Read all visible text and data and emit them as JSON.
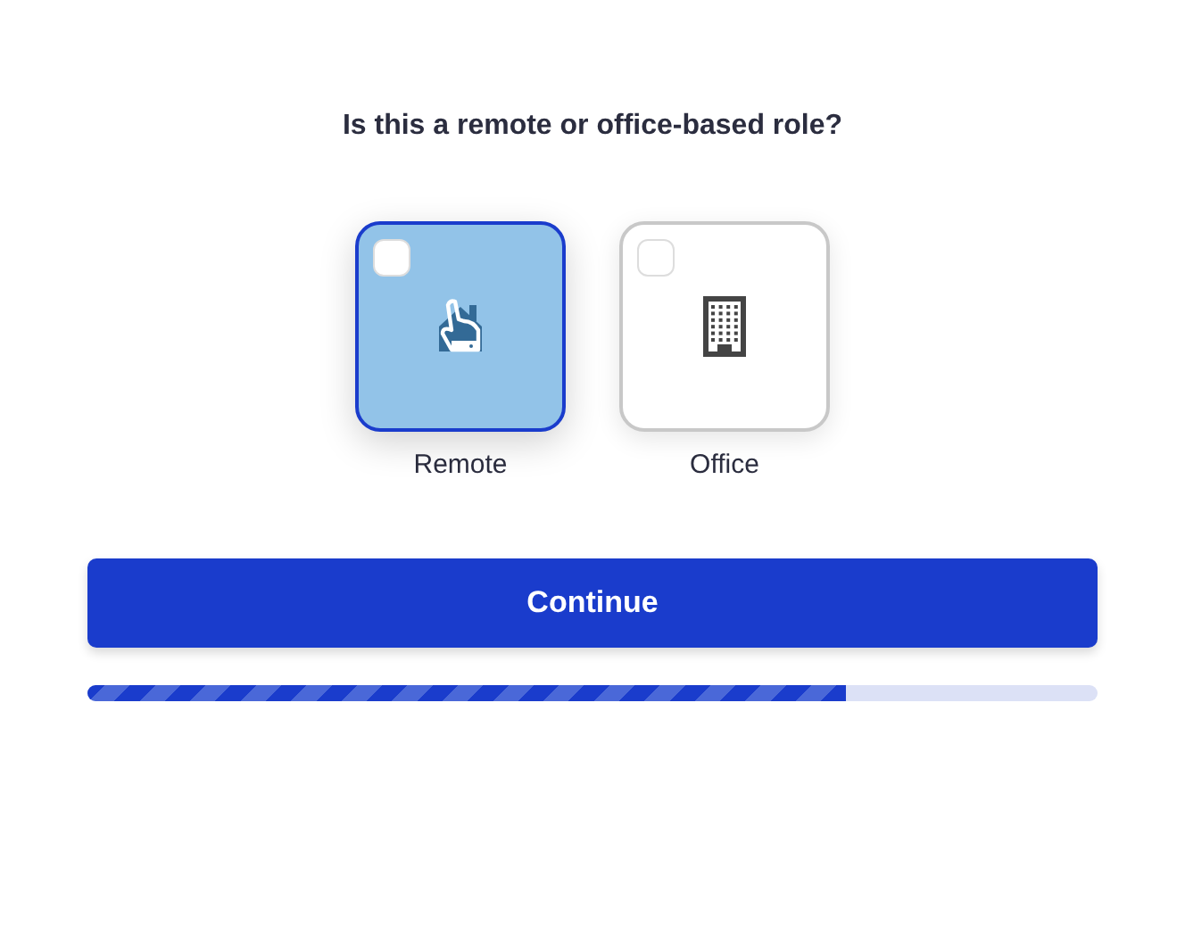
{
  "question": "Is this a remote or office-based role?",
  "options": [
    {
      "kind": "remote",
      "label": "Remote",
      "selected": true,
      "checked": false
    },
    {
      "kind": "office",
      "label": "Office",
      "selected": false,
      "checked": false
    }
  ],
  "button": "Continue",
  "progress": {
    "level": 0.75
  }
}
